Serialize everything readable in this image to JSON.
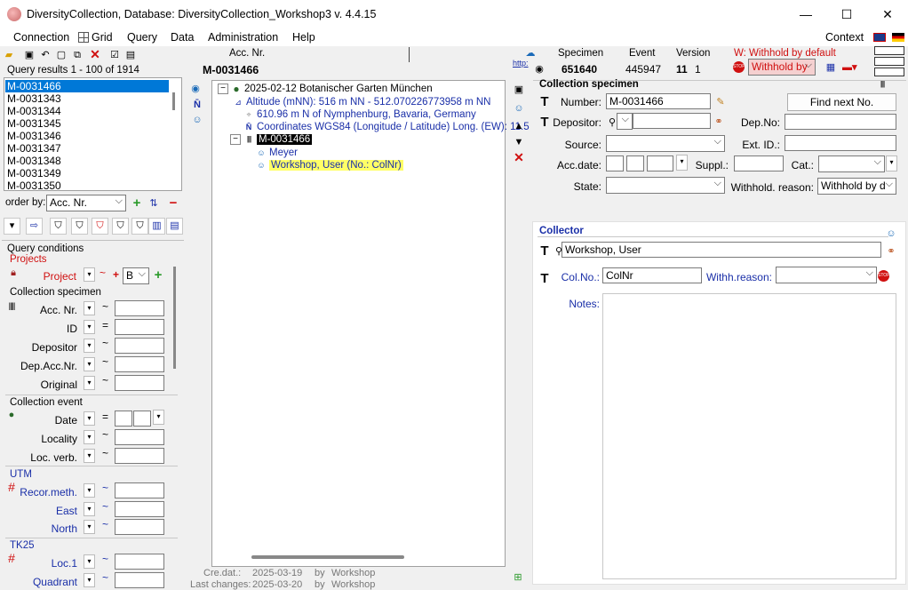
{
  "window": {
    "title": "DiversityCollection,  Database: DiversityCollection_Workshop3    v. 4.4.15",
    "minimize": "—",
    "maximize": "☐",
    "close": "✕"
  },
  "menu": {
    "items": [
      "Connection",
      "Grid",
      "Query",
      "Data",
      "Administration",
      "Help"
    ],
    "context": "Context"
  },
  "query": {
    "results_label": "Query results  1 - 100 of 1914",
    "results": [
      "M-0031466",
      "M-0031343",
      "M-0031344",
      "M-0031345",
      "M-0031346",
      "M-0031347",
      "M-0031348",
      "M-0031349",
      "M-0031350"
    ],
    "order_by_label": "order by:",
    "order_by_value": "Acc. Nr.",
    "conditions_label": "Query conditions",
    "projects_section": "Projects",
    "project_label": "Project",
    "project_value": "B",
    "specimen_section": "Collection specimen",
    "specimen_fields": [
      "Acc. Nr.",
      "ID",
      "Depositor",
      "Dep.Acc.Nr.",
      "Original"
    ],
    "specimen_ops": [
      "~",
      "=",
      "~",
      "~",
      "~"
    ],
    "event_section": "Collection event",
    "event_fields": [
      "Date",
      "Locality",
      "Loc. verb."
    ],
    "event_ops": [
      "=",
      "~",
      "~"
    ],
    "utm_section": "UTM",
    "utm_fields": [
      "Recor.meth.",
      "East",
      "North"
    ],
    "tk25_section": "TK25",
    "tk25_fields": [
      "Loc.1",
      "Quadrant"
    ]
  },
  "header": {
    "acc_label": "Acc. Nr.",
    "acc_value": "M-0031466",
    "specimen_label": "Specimen",
    "specimen_value": "651640",
    "event_label": "Event",
    "event_value": "445947",
    "version_label": "Version",
    "version_value": "11",
    "version_sub": "1",
    "withhold_label": "W: Withhold by default",
    "withhold_value": "Withhold by",
    "http": "http:"
  },
  "tree": {
    "event": "2025-02-12 Botanischer Garten München",
    "altitude": "Altitude (mNN): 516 m NN - 512.070226773958 m NN",
    "named_area": "610.96 m N of  Nymphenburg, Bavaria, Germany",
    "coordinates": "Coordinates WGS84 (Longitude / Latitude) Long. (EW): 11.5",
    "specimen": "M-0031466",
    "agent1": "Meyer",
    "agent2": "Workshop, User (No.: ColNr)"
  },
  "footer": {
    "created_label": "Cre.dat.:",
    "created_date": "2025-03-19",
    "created_by_label": "by",
    "created_by": "Workshop",
    "changed_label": "Last changes:",
    "changed_date": "2025-03-20",
    "changed_by_label": "by",
    "changed_by": "Workshop"
  },
  "specimen_form": {
    "title": "Collection specimen",
    "number_label": "Number:",
    "number_value": "M-0031466",
    "find_next": "Find next No.",
    "depositor_label": "Depositor:",
    "depno_label": "Dep.No:",
    "source_label": "Source:",
    "extid_label": "Ext. ID.:",
    "accdate_label": "Acc.date:",
    "suppl_label": "Suppl.:",
    "cat_label": "Cat.:",
    "state_label": "State:",
    "withhold_label": "Withhold. reason:",
    "withhold_value": "Withhold by d"
  },
  "collector_form": {
    "title": "Collector",
    "name_value": "Workshop, User",
    "colno_label": "Col.No.:",
    "colno_value": "ColNr",
    "withh_label": "Withh.reason:",
    "notes_label": "Notes:"
  },
  "colors": {
    "selection": "#0078d7",
    "highlight": "#ffff66",
    "link_blue": "#1a2fa8",
    "red": "#d01010"
  }
}
